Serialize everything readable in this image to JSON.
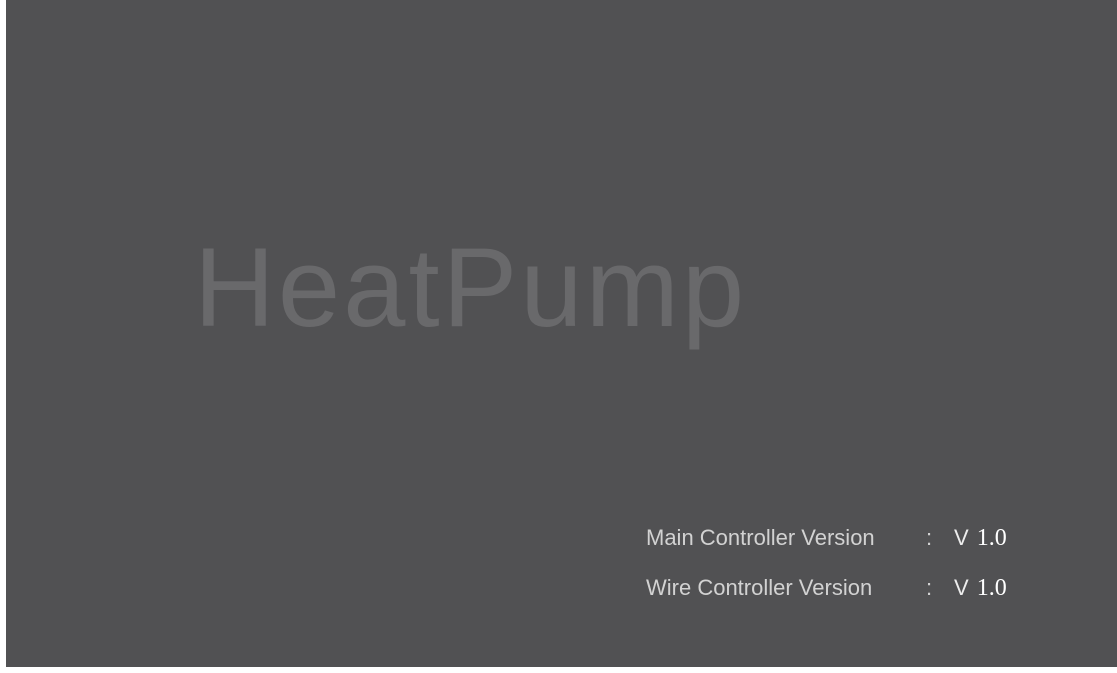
{
  "splash": {
    "logo_text": "HeatPump",
    "colors": {
      "background": "#515153",
      "logo": "#69696b",
      "text": "#d2d2d2"
    }
  },
  "versions": [
    {
      "label": "Main Controller Version",
      "separator": ":",
      "prefix": "V",
      "number": "1.0"
    },
    {
      "label": "Wire Controller Version",
      "separator": ":",
      "prefix": "V",
      "number": "1.0"
    }
  ]
}
